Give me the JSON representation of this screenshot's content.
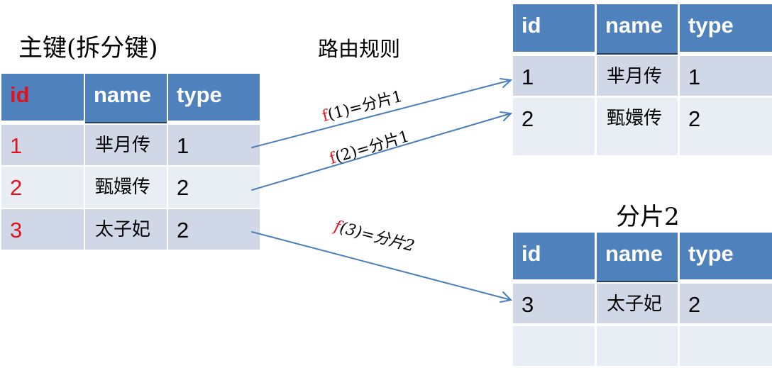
{
  "labels": {
    "primary_key": "主键(拆分键)",
    "routing_rule": "路由规则",
    "shard2_title": "分片2"
  },
  "headers": [
    "id",
    "name",
    "type"
  ],
  "source_table": {
    "rows": [
      {
        "id": "1",
        "name": "芈月传",
        "type": "1"
      },
      {
        "id": "2",
        "name": "甄嬛传",
        "type": "2"
      },
      {
        "id": "3",
        "name": "太子妃",
        "type": "2"
      }
    ]
  },
  "shard1_table": {
    "rows": [
      {
        "id": "1",
        "name": "芈月传",
        "type": "1"
      },
      {
        "id": "2",
        "name": "甄嬛传",
        "type": "2"
      }
    ]
  },
  "shard2_table": {
    "rows": [
      {
        "id": "3",
        "name": "太子妃",
        "type": "2"
      },
      {
        "id": "",
        "name": "",
        "type": ""
      }
    ]
  },
  "rules": [
    {
      "fn": "f",
      "expr": "(1)=分片1"
    },
    {
      "fn": "f",
      "expr": "(2)=分片1"
    },
    {
      "fn": "f",
      "expr": "(3)=分片2"
    }
  ],
  "colors": {
    "header": "#4f81bd",
    "row_dark": "#d0d8e8",
    "row_light": "#e9edf4",
    "arrow": "#4a7ebb",
    "key_red": "#e0141e"
  }
}
